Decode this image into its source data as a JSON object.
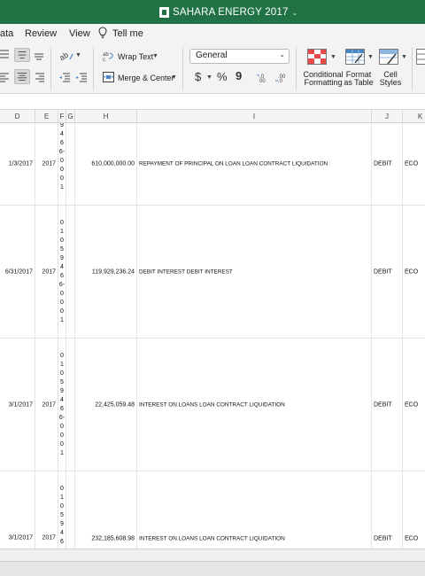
{
  "window": {
    "title": "SAHARA ENERGY 2017"
  },
  "ribbon_tabs": [
    {
      "label": "ata"
    },
    {
      "label": "Review"
    },
    {
      "label": "View"
    },
    {
      "label": "Tell me"
    }
  ],
  "ribbon": {
    "wrap_text": "Wrap Text",
    "merge_center": "Merge & Center",
    "number_format": "General",
    "currency": "$",
    "percent": "%",
    "comma": "9",
    "conditional_formatting_1": "Conditional",
    "conditional_formatting_2": "Formatting",
    "format_table_1": "Format",
    "format_table_2": "as Table",
    "cell_styles_1": "Cell",
    "cell_styles_2": "Styles"
  },
  "columns": [
    "D",
    "E",
    "F",
    "G",
    "H",
    "I",
    "J",
    "K"
  ],
  "rows": [
    {
      "date": "1/3/2017",
      "year": "2017",
      "account_chars": [
        "9",
        "4",
        "6",
        "6-",
        "0",
        "0",
        "0",
        "1"
      ],
      "amount": "610,000,000.00",
      "description": "REPAYMENT OF PRINCIPAL ON LOAN LOAN CONTRACT LIQUIDATION",
      "type": "DEBIT",
      "code": "ECO"
    },
    {
      "date": "6/31/2017",
      "year": "2017",
      "account_chars": [
        "0",
        "1",
        "0",
        "5",
        "9",
        "4",
        "6",
        "6-",
        "0",
        "0",
        "0",
        "1"
      ],
      "amount": "119,929,236.24",
      "description": "DEBIT INTEREST DEBIT INTEREST",
      "type": "DEBIT",
      "code": "ECO"
    },
    {
      "date": "3/1/2017",
      "year": "2017",
      "account_chars": [
        "0",
        "1",
        "0",
        "5",
        "9",
        "4",
        "6",
        "6-",
        "0",
        "0",
        "0",
        "1"
      ],
      "amount": "22,425,059.48",
      "description": "INTEREST ON LOANS LOAN CONTRACT LIQUIDATION",
      "type": "DEBIT",
      "code": "ECO"
    },
    {
      "date": "3/1/2017",
      "year": "2017",
      "account_chars": [
        "0",
        "1",
        "0",
        "5",
        "9",
        "4",
        "6"
      ],
      "amount": "232,185,608.98",
      "description": "INTEREST ON LOANS LOAN CONTRACT LIQUIDATION",
      "type": "DEBIT",
      "code": "ECO"
    }
  ],
  "colors": {
    "excel_green": "#217346",
    "ribbon_bg": "#f3f3f3",
    "grid_line": "#e1e1e1"
  },
  "icons": [
    "excel-logo-icon",
    "lightbulb-icon",
    "align-icons",
    "orientation-icon",
    "wrap-text-icon",
    "merge-center-icon",
    "conditional-formatting-icon",
    "format-as-table-icon",
    "cell-styles-icon"
  ]
}
